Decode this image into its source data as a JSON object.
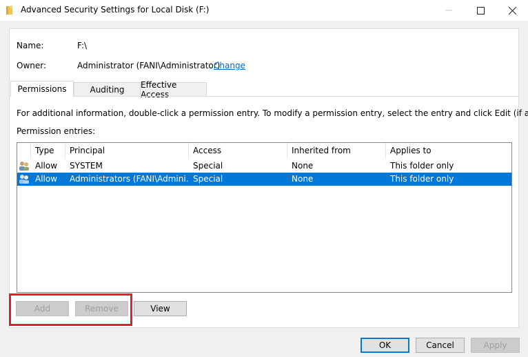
{
  "window": {
    "title": "Advanced Security Settings for Local Disk (F:)",
    "icon": "folder-icon"
  },
  "info": {
    "name_label": "Name:",
    "name_value": "F:\\",
    "owner_label": "Owner:",
    "owner_value": "Administrator (FANI\\Administrator)",
    "change_link": "Change"
  },
  "tabs": [
    {
      "label": "Permissions",
      "active": true
    },
    {
      "label": "Auditing",
      "active": false
    },
    {
      "label": "Effective Access",
      "active": false
    }
  ],
  "permissions": {
    "instruction": "For additional information, double-click a permission entry. To modify a permission entry, select the entry and click Edit (if available).",
    "entries_label": "Permission entries:",
    "columns": [
      "Type",
      "Principal",
      "Access",
      "Inherited from",
      "Applies to"
    ],
    "rows": [
      {
        "type": "Allow",
        "principal": "SYSTEM",
        "access": "Special",
        "inherited_from": "None",
        "applies_to": "This folder only",
        "selected": false
      },
      {
        "type": "Allow",
        "principal": "Administrators (FANI\\Admini...",
        "access": "Special",
        "inherited_from": "None",
        "applies_to": "This folder only",
        "selected": true
      }
    ],
    "add_button": "Add",
    "remove_button": "Remove",
    "view_button": "View"
  },
  "footer": {
    "ok_button": "OK",
    "cancel_button": "Cancel",
    "apply_button": "Apply"
  },
  "colors": {
    "selection": "#0078d7",
    "link": "#0066cc",
    "highlight_box": "#e0202b"
  }
}
